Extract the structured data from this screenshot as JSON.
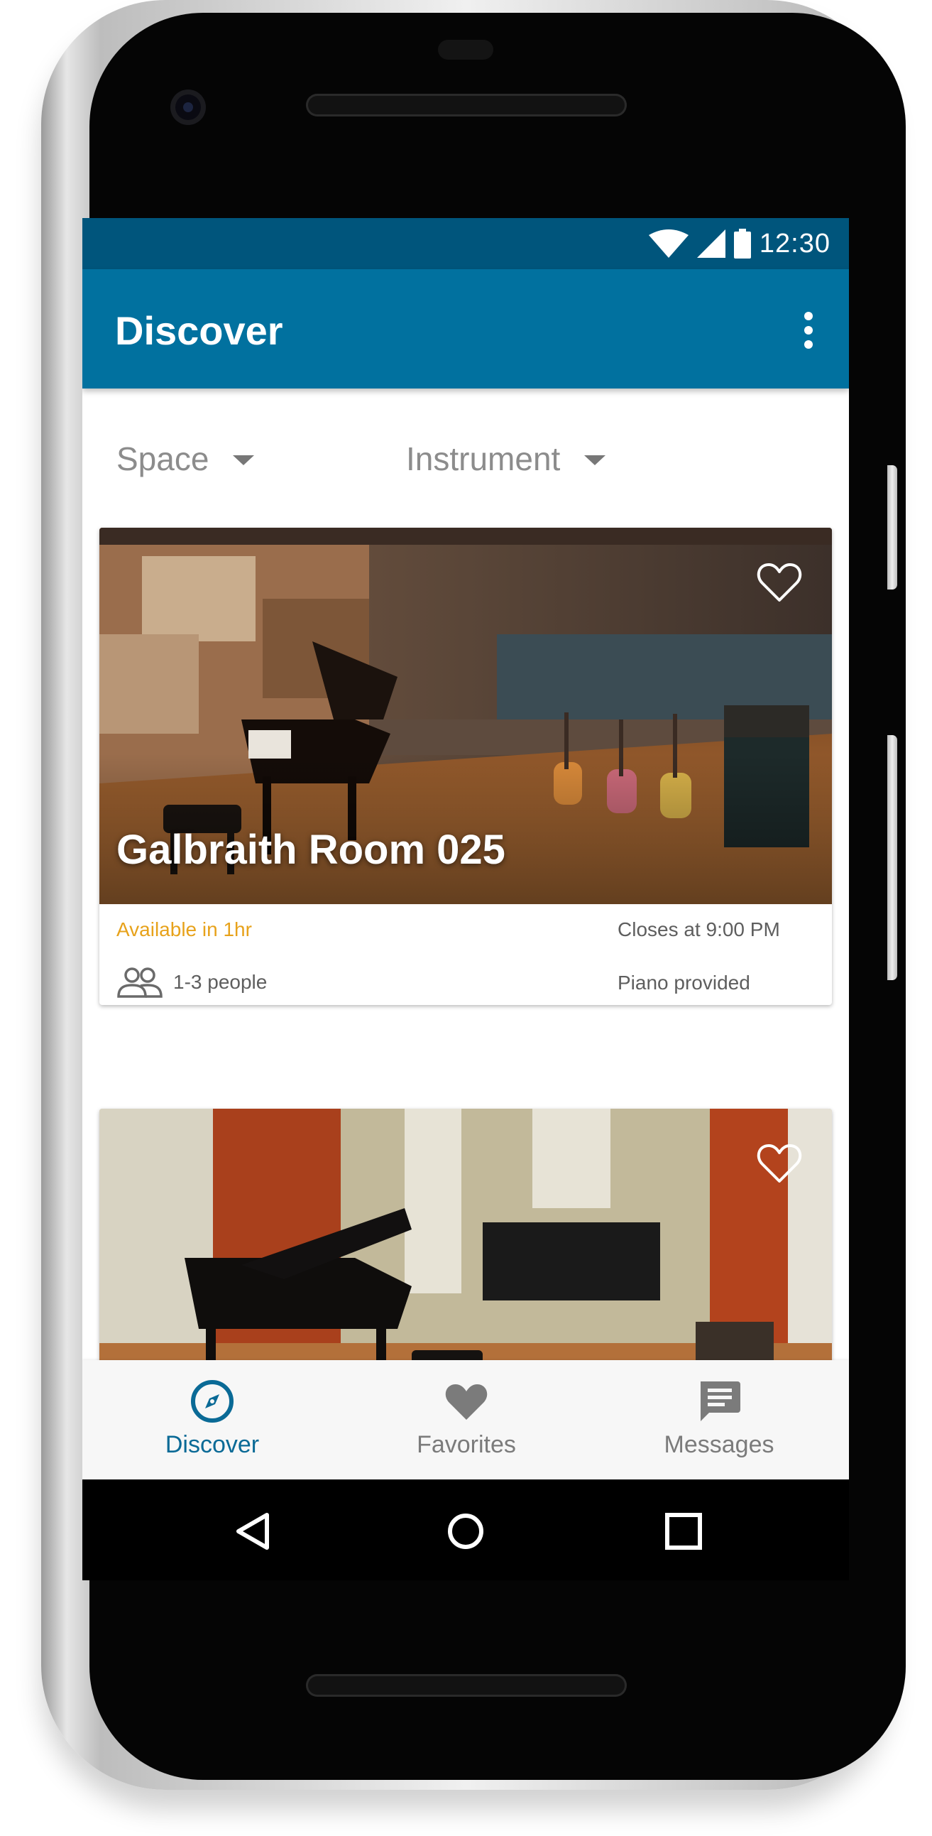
{
  "status_bar": {
    "time": "12:30",
    "icons": [
      "wifi-icon",
      "cell-signal-icon",
      "battery-icon"
    ]
  },
  "app_bar": {
    "title": "Discover",
    "menu_icon": "more-vert-icon"
  },
  "filters": [
    {
      "label": "Space"
    },
    {
      "label": "Instrument"
    }
  ],
  "listings": [
    {
      "title": "Galbraith Room 025",
      "availability": "Available in 1hr",
      "closes": "Closes at 9:00 PM",
      "capacity": "1-3 people",
      "amenity": "Piano provided",
      "favorited": false
    },
    {
      "title": "",
      "favorited": false
    }
  ],
  "bottom_nav": {
    "items": [
      {
        "label": "Discover",
        "icon": "compass-icon",
        "active": true
      },
      {
        "label": "Favorites",
        "icon": "heart-icon",
        "active": false
      },
      {
        "label": "Messages",
        "icon": "message-icon",
        "active": false
      }
    ]
  },
  "system_nav": [
    "back-icon",
    "home-icon",
    "recents-icon"
  ],
  "colors": {
    "status_bar": "#00557c",
    "app_bar": "#01719f",
    "accent": "#0a6a96",
    "availability": "#e7a21b"
  }
}
